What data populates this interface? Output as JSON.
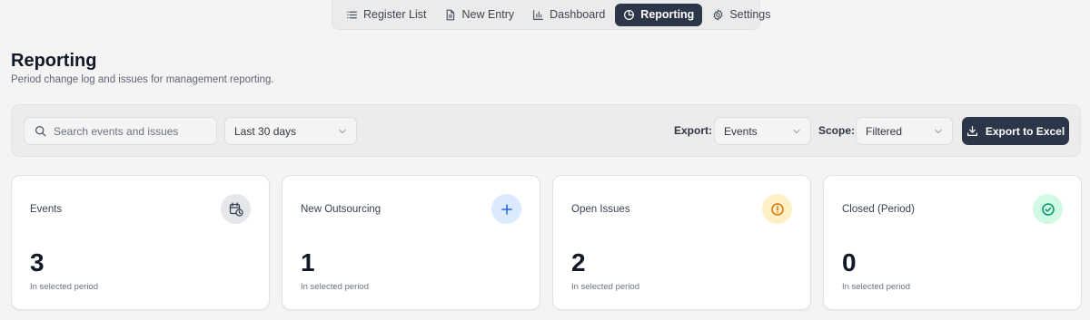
{
  "nav": {
    "items": [
      {
        "label": "Register List",
        "icon": "list-icon"
      },
      {
        "label": "New Entry",
        "icon": "document-icon"
      },
      {
        "label": "Dashboard",
        "icon": "bar-chart-icon"
      },
      {
        "label": "Reporting",
        "icon": "pie-chart-icon",
        "active": true
      },
      {
        "label": "Settings",
        "icon": "gear-icon"
      }
    ]
  },
  "header": {
    "title": "Reporting",
    "subtitle": "Period change log and issues for management reporting."
  },
  "toolbar": {
    "search_placeholder": "Search events and issues",
    "period_value": "Last 30 days",
    "export_label": "Export:",
    "export_value": "Events",
    "scope_label": "Scope:",
    "scope_value": "Filtered",
    "export_button": "Export to Excel"
  },
  "cards": [
    {
      "label": "Events",
      "value": "3",
      "caption": "In selected period",
      "icon": "calendar-clock-icon",
      "icon_bg": "#e5e7eb",
      "icon_color": "#374151"
    },
    {
      "label": "New Outsourcing",
      "value": "1",
      "caption": "In selected period",
      "icon": "plus-icon",
      "icon_bg": "#dbeafe",
      "icon_color": "#2563eb"
    },
    {
      "label": "Open Issues",
      "value": "2",
      "caption": "In selected period",
      "icon": "alert-circle-icon",
      "icon_bg": "#fdf0c4",
      "icon_color": "#d97706"
    },
    {
      "label": "Closed (Period)",
      "value": "0",
      "caption": "In selected period",
      "icon": "check-circle-icon",
      "icon_bg": "#d1fae5",
      "icon_color": "#059669"
    }
  ],
  "colors": {
    "accent": "#2b3648",
    "background": "#f4f4f4"
  }
}
